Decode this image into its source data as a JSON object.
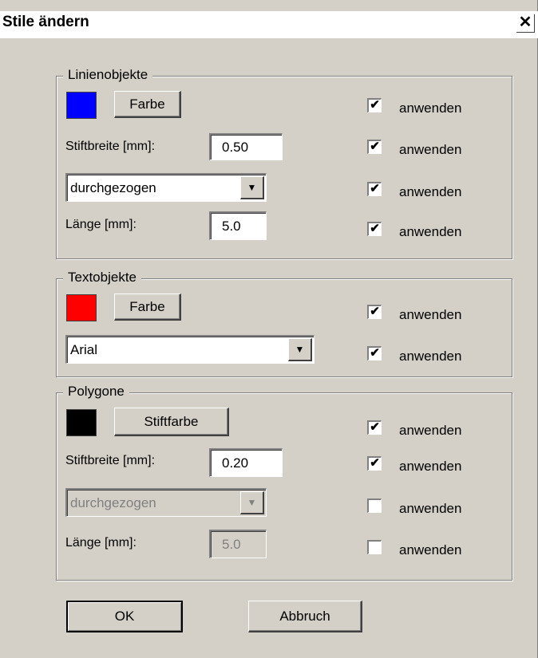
{
  "window": {
    "title": "Stile ändern",
    "close_glyph": "✕"
  },
  "linien": {
    "legend": "Linienobjekte",
    "color": "#0000ff",
    "color_button": "Farbe",
    "penwidth_label": "Stiftbreite [mm]:",
    "penwidth_value": "0.50",
    "linestyle": "durchgezogen",
    "length_label": "Länge [mm]:",
    "length_value": "5.0",
    "apply": [
      {
        "label": "anwenden",
        "checked": true
      },
      {
        "label": "anwenden",
        "checked": true
      },
      {
        "label": "anwenden",
        "checked": true
      },
      {
        "label": "anwenden",
        "checked": true
      }
    ]
  },
  "text": {
    "legend": "Textobjekte",
    "color": "#ff0000",
    "color_button": "Farbe",
    "font": "Arial",
    "apply": [
      {
        "label": "anwenden",
        "checked": true
      },
      {
        "label": "anwenden",
        "checked": true
      }
    ]
  },
  "polygone": {
    "legend": "Polygone",
    "color": "#000000",
    "color_button": "Stiftfarbe",
    "penwidth_label": "Stiftbreite [mm]:",
    "penwidth_value": "0.20",
    "linestyle": "durchgezogen",
    "length_label": "Länge [mm]:",
    "length_value": "5.0",
    "apply": [
      {
        "label": "anwenden",
        "checked": true
      },
      {
        "label": "anwenden",
        "checked": true
      },
      {
        "label": "anwenden",
        "checked": false
      },
      {
        "label": "anwenden",
        "checked": false
      }
    ]
  },
  "buttons": {
    "ok": "OK",
    "cancel": "Abbruch"
  },
  "icons": {
    "dropdown": "▼",
    "check": "✔"
  }
}
